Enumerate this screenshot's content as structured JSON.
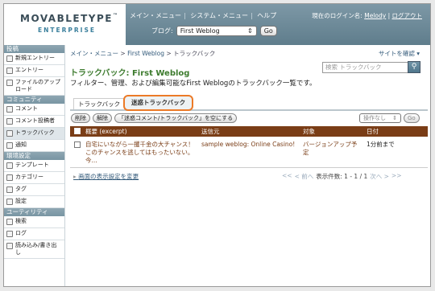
{
  "header": {
    "logo_main": "MOVABLETYPE",
    "logo_tm": "™",
    "logo_sub": "ENTERPRISE",
    "nav": [
      "メイン・メニュー",
      "システム・メニュー",
      "ヘルプ"
    ],
    "login_label": "現在のログイン名:",
    "login_user": "Melody",
    "logout": "ログアウト",
    "blog_label": "ブログ:",
    "blog_value": "First Weblog",
    "go": "Go"
  },
  "sidebar": {
    "sections": [
      {
        "title": "投稿",
        "items": [
          "新規エントリー",
          "エントリー",
          "ファイルのアップロード"
        ]
      },
      {
        "title": "コミュニティ",
        "items": [
          "コメント",
          "コメント投稿者",
          "トラックバック",
          "通知"
        ]
      },
      {
        "title": "環境設定",
        "items": [
          "テンプレート",
          "カテゴリー",
          "タグ",
          "設定"
        ]
      },
      {
        "title": "ユーティリティ",
        "items": [
          "検索",
          "ログ",
          "読み込み/書き出し"
        ]
      }
    ],
    "active": "トラックバック"
  },
  "main": {
    "breadcrumb": [
      "メイン・メニュー",
      "First Weblog",
      "トラックバック"
    ],
    "site_link": "サイトを確認",
    "title": "トラックバック: First Weblog",
    "search_placeholder": "検索 トラックバック",
    "description": "フィルター、管理、および編集可能なFirst Weblogのトラックバック一覧です。",
    "tabs": [
      "トラックバック",
      "迷惑トラックバック"
    ],
    "actions": [
      "削除",
      "解除",
      "「迷惑コメント/トラックバック」を空にする"
    ],
    "more_select": "操作なし",
    "more_go": "Go",
    "columns": [
      "概要 (excerpt)",
      "送信元",
      "対象",
      "日付"
    ],
    "rows": [
      {
        "excerpt": "自宅にいながら一攫千金の大チャンス！ このチャンスを逃してはもったいない。 今...",
        "source": "sample weblog: Online Casino!",
        "target": "バージョンアップ予定",
        "date": "1分前まで"
      }
    ],
    "display_options": "画面の表示設定を変更",
    "pager": {
      "first": "<<",
      "prev": "< 前へ",
      "count_label": "表示件数: 1 - 1 / 1",
      "next": "次へ >",
      "last": ">>"
    }
  }
}
